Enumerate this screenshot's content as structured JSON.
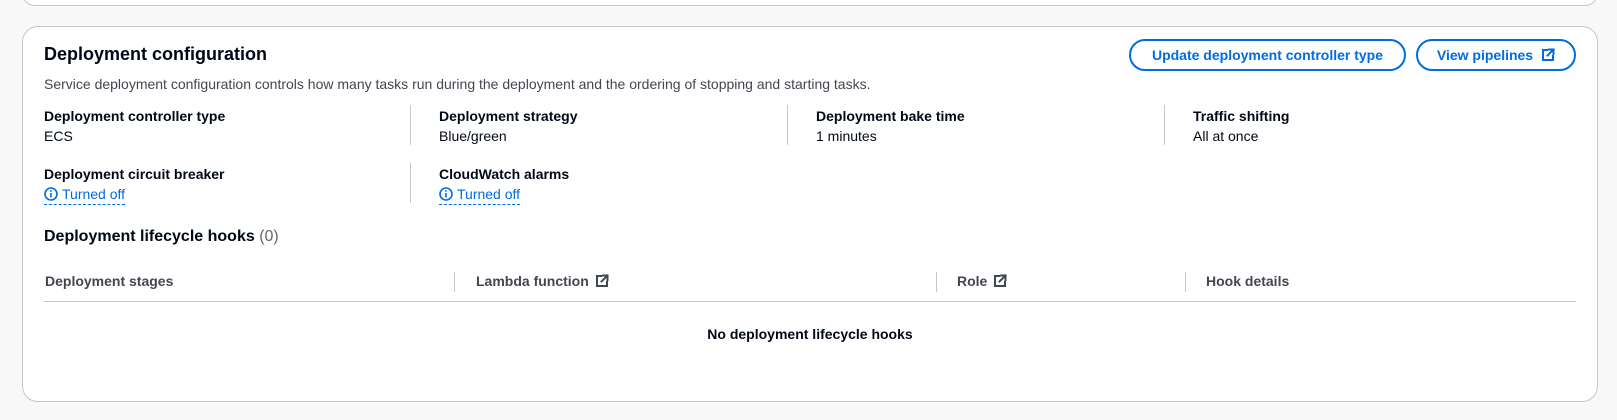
{
  "section": {
    "title": "Deployment configuration",
    "description": "Service deployment configuration controls how many tasks run during the deployment and the ordering of stopping and starting tasks.",
    "buttons": {
      "update_label": "Update deployment controller type",
      "pipelines_label": "View pipelines"
    }
  },
  "config": {
    "controller_type": {
      "label": "Deployment controller type",
      "value": "ECS"
    },
    "strategy": {
      "label": "Deployment strategy",
      "value": "Blue/green"
    },
    "bake_time": {
      "label": "Deployment bake time",
      "value": "1 minutes"
    },
    "traffic_shifting": {
      "label": "Traffic shifting",
      "value": "All at once"
    },
    "circuit_breaker": {
      "label": "Deployment circuit breaker",
      "value": "Turned off",
      "icon": "info-icon"
    },
    "cloudwatch_alarms": {
      "label": "CloudWatch alarms",
      "value": "Turned off",
      "icon": "info-icon"
    }
  },
  "hooks": {
    "title": "Deployment lifecycle hooks",
    "count": "(0)",
    "columns": [
      "Deployment stages",
      "Lambda function",
      "Role",
      "Hook details"
    ],
    "empty_message": "No deployment lifecycle hooks"
  },
  "colors": {
    "link": "#006ce0",
    "border": "#c6c6cd",
    "text": "#000716",
    "secondary_text": "#424650"
  }
}
